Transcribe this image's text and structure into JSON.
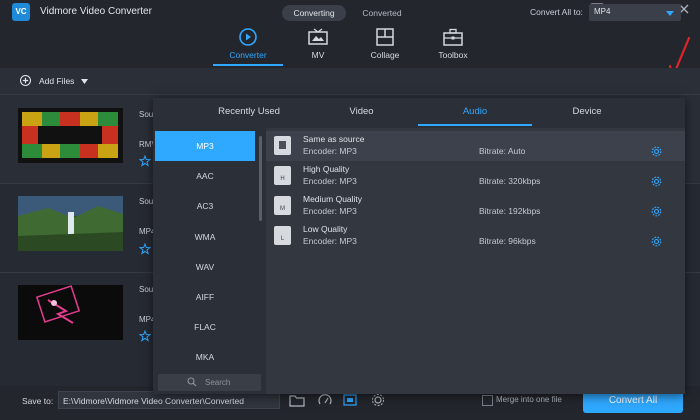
{
  "app": {
    "logo_text": "VC",
    "title": "Vidmore Video Converter"
  },
  "window_controls": {
    "feedback_icon": "feedback-icon",
    "menu_icon": "menu-icon",
    "minimize_icon": "minimize-icon",
    "maximize_icon": "maximize-icon",
    "close_icon": "close-icon"
  },
  "nav": {
    "tabs": [
      {
        "label": "Converter",
        "icon": "converter-icon",
        "active": true
      },
      {
        "label": "MV",
        "icon": "mv-icon",
        "active": false
      },
      {
        "label": "Collage",
        "icon": "collage-icon",
        "active": false
      },
      {
        "label": "Toolbox",
        "icon": "toolbox-icon",
        "active": false
      }
    ]
  },
  "toolbar": {
    "add_files": "Add Files",
    "segment": [
      "Converting",
      "Converted"
    ],
    "convert_all_label": "Convert All to:",
    "convert_all_value": "MP4"
  },
  "files": [
    {
      "name_fragment": "Sou",
      "format_fragment": "RMV"
    },
    {
      "name_fragment": "Sou",
      "format_fragment": "MP4"
    },
    {
      "name_fragment": "Sou",
      "format_fragment": "MP4"
    }
  ],
  "panel": {
    "tabs": [
      "Recently Used",
      "Video",
      "Audio",
      "Device"
    ],
    "active_tab": "Audio",
    "formats": [
      "MP3",
      "AAC",
      "AC3",
      "WMA",
      "WAV",
      "AIFF",
      "FLAC",
      "MKA"
    ],
    "active_format": "MP3",
    "search_placeholder": "Search",
    "options": [
      {
        "name": "Same as source",
        "encoder": "Encoder: MP3",
        "bitrate": "Bitrate: Auto",
        "badge": ""
      },
      {
        "name": "High Quality",
        "encoder": "Encoder: MP3",
        "bitrate": "Bitrate: 320kbps",
        "badge": "H"
      },
      {
        "name": "Medium Quality",
        "encoder": "Encoder: MP3",
        "bitrate": "Bitrate: 192kbps",
        "badge": "M"
      },
      {
        "name": "Low Quality",
        "encoder": "Encoder: MP3",
        "bitrate": "Bitrate: 96kbps",
        "badge": "L"
      }
    ]
  },
  "bottom": {
    "save_to_label": "Save to:",
    "save_path": "E:\\Vidmore\\Vidmore Video Converter\\Converted",
    "merge_label": "Merge into one file",
    "convert_all_button": "Convert All"
  },
  "colors": {
    "accent": "#2fa8ff",
    "background": "#262a33",
    "annotation_arrow": "#e0242b"
  }
}
